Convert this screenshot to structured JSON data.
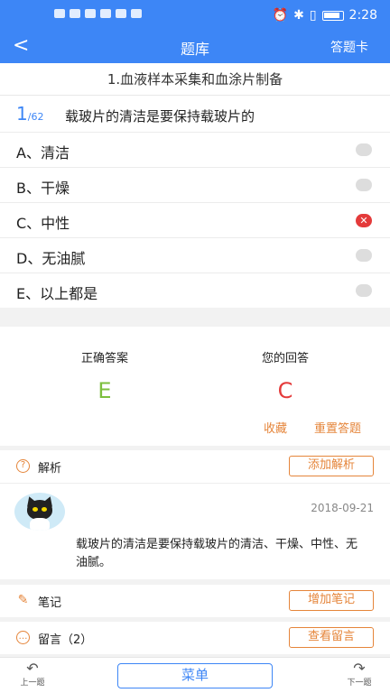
{
  "status_bar": {
    "time": "2:28"
  },
  "nav": {
    "back_icon": "chevron-left-icon",
    "title": "题库",
    "answer_card": "答题卡"
  },
  "subject": "1.血液样本采集和血涂片制备",
  "question": {
    "number": "1",
    "total": "/62",
    "text": "载玻片的清洁是要保持载玻片的"
  },
  "options": [
    {
      "label": "A、清洁",
      "state": "unselected"
    },
    {
      "label": "B、干燥",
      "state": "unselected"
    },
    {
      "label": "C、中性",
      "state": "wrong"
    },
    {
      "label": "D、无油腻",
      "state": "unselected"
    },
    {
      "label": "E、以上都是",
      "state": "unselected"
    }
  ],
  "answer": {
    "correct_title": "正确答案",
    "correct_value": "E",
    "yours_title": "您的回答",
    "yours_value": "C",
    "favorite": "收藏",
    "reset": "重置答题"
  },
  "analysis_row": {
    "label": "解析",
    "button": "添加解析"
  },
  "analysis_comment": {
    "date": "2018-09-21",
    "text": "载玻片的清洁是要保持载玻片的清洁、干燥、中性、无油腻。"
  },
  "notes_row": {
    "label": "笔记",
    "button": "增加笔记"
  },
  "messages_row": {
    "label": "留言（2）",
    "button": "查看留言"
  },
  "bottom": {
    "prev": "上一题",
    "menu": "菜单",
    "next": "下一题"
  },
  "colors": {
    "primary": "#3d86f6",
    "accent": "#e5853a",
    "correct": "#7dbf3e",
    "wrong": "#e43b3b"
  }
}
